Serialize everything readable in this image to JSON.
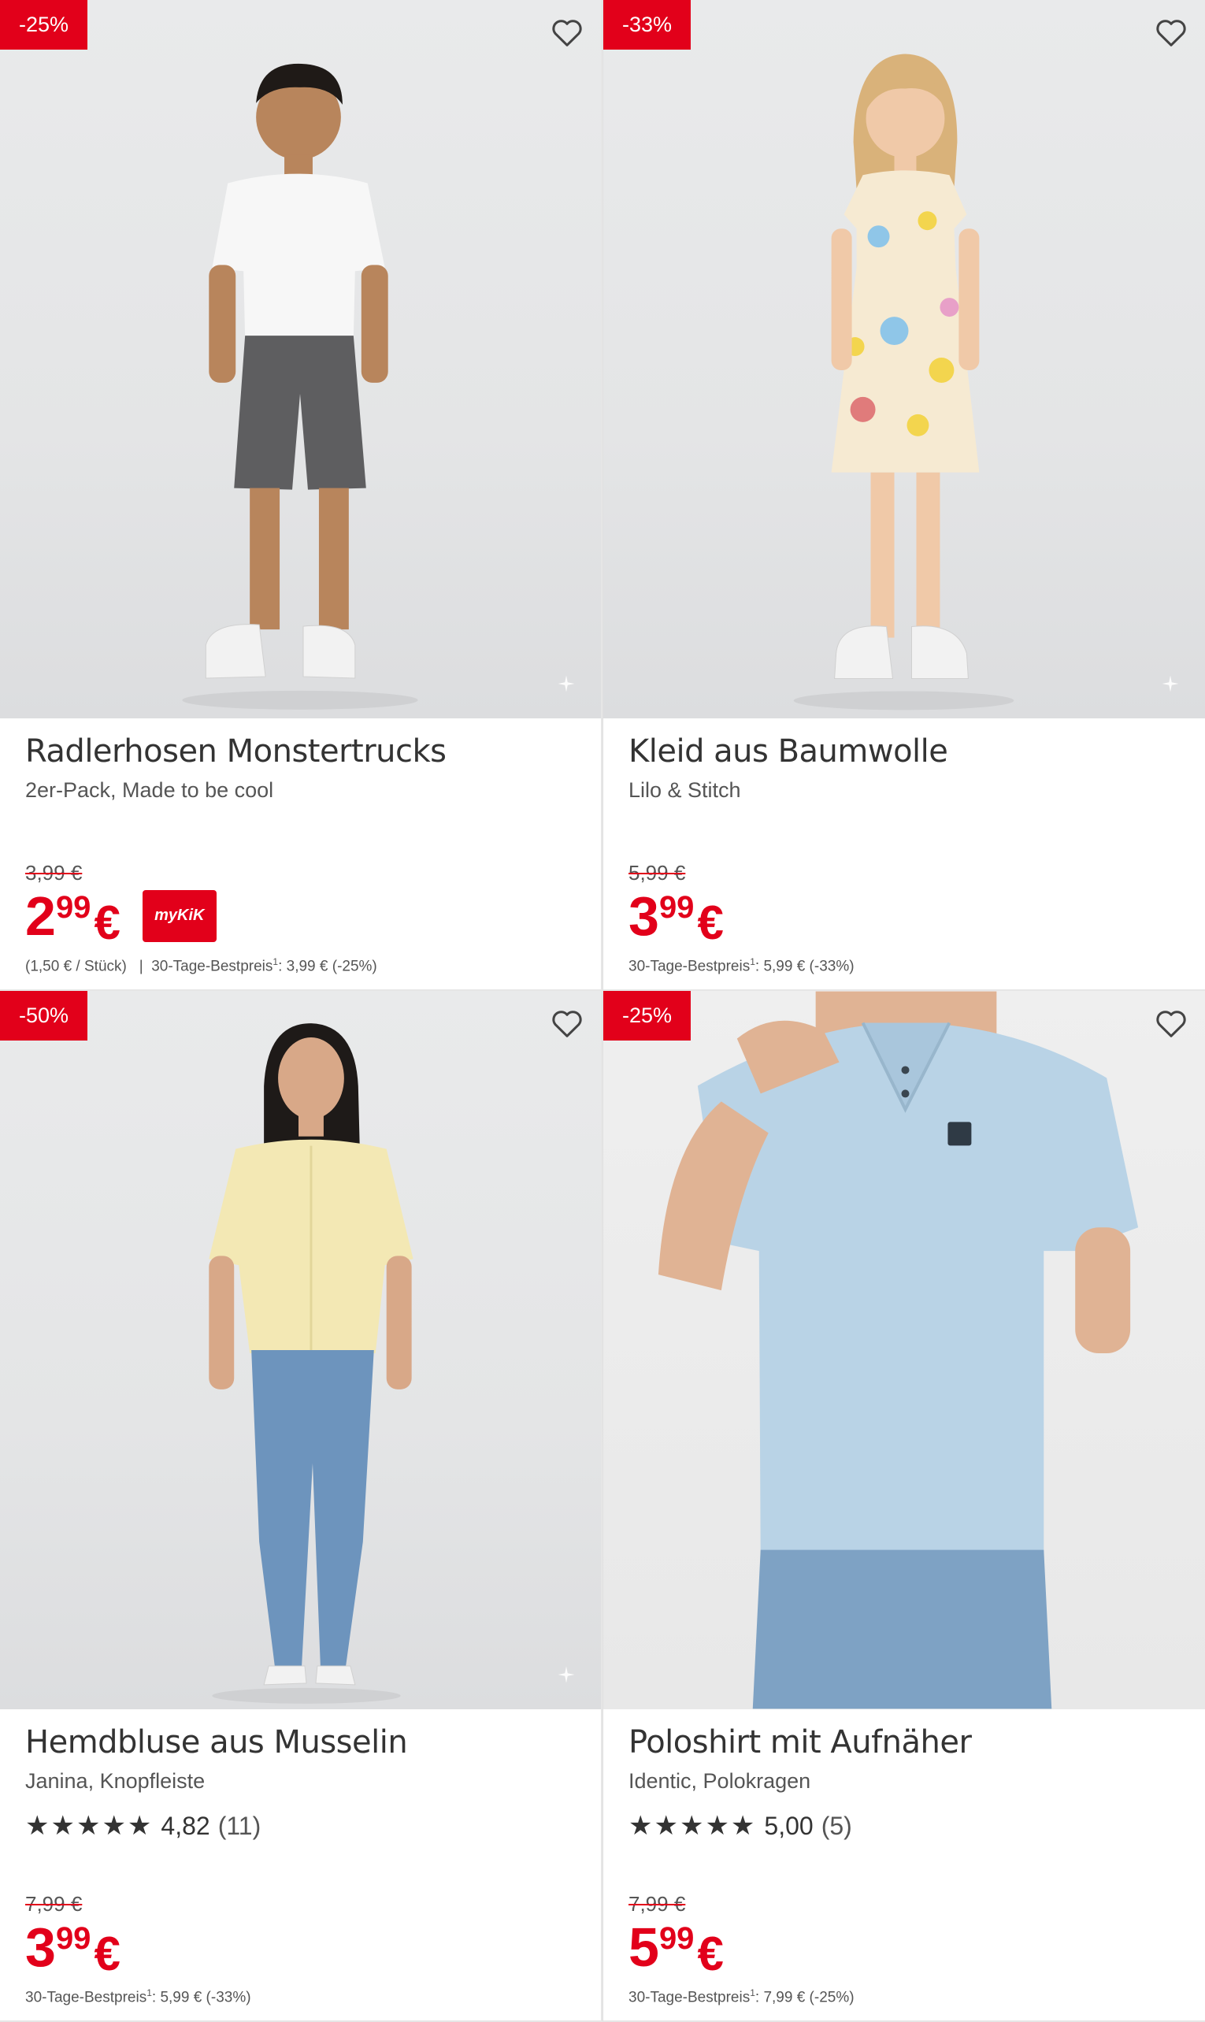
{
  "colors": {
    "accent": "#e2001a",
    "text": "#333333",
    "muted": "#555555"
  },
  "products": [
    {
      "badge": "-25%",
      "title": "Radlerhosen Monstertrucks",
      "subtitle": "2er-Pack, Made to be cool",
      "old_price": "3,99 €",
      "price_int": "2",
      "price_dec": "99",
      "currency": "€",
      "mykik": "myKiK",
      "unit_price": "(1,50 € / Stück)",
      "separator": "|",
      "best_label": "30-Tage-Bestpreis",
      "best_sup": "1",
      "best_value": ": 3,99 € (-25%)"
    },
    {
      "badge": "-33%",
      "title": "Kleid aus Baumwolle",
      "subtitle": "Lilo & Stitch",
      "old_price": "5,99 €",
      "price_int": "3",
      "price_dec": "99",
      "currency": "€",
      "best_label": "30-Tage-Bestpreis",
      "best_sup": "1",
      "best_value": ": 5,99 € (-33%)"
    },
    {
      "badge": "-50%",
      "title": "Hemdbluse aus Musselin",
      "subtitle": "Janina, Knopfleiste",
      "stars": "★★★★★",
      "rating": "4,82",
      "rating_count": "(11)",
      "old_price": "7,99 €",
      "price_int": "3",
      "price_dec": "99",
      "currency": "€",
      "best_label": "30-Tage-Bestpreis",
      "best_sup": "1",
      "best_value": ": 5,99 € (-33%)"
    },
    {
      "badge": "-25%",
      "title": "Poloshirt mit Aufnäher",
      "subtitle": "Identic, Polokragen",
      "stars": "★★★★★",
      "rating": "5,00",
      "rating_count": "(5)",
      "old_price": "7,99 €",
      "price_int": "5",
      "price_dec": "99",
      "currency": "€",
      "best_label": "30-Tage-Bestpreis",
      "best_sup": "1",
      "best_value": ": 7,99 € (-25%)"
    }
  ],
  "icons": [
    "heart-outline-icon",
    "sparkle-icon"
  ]
}
